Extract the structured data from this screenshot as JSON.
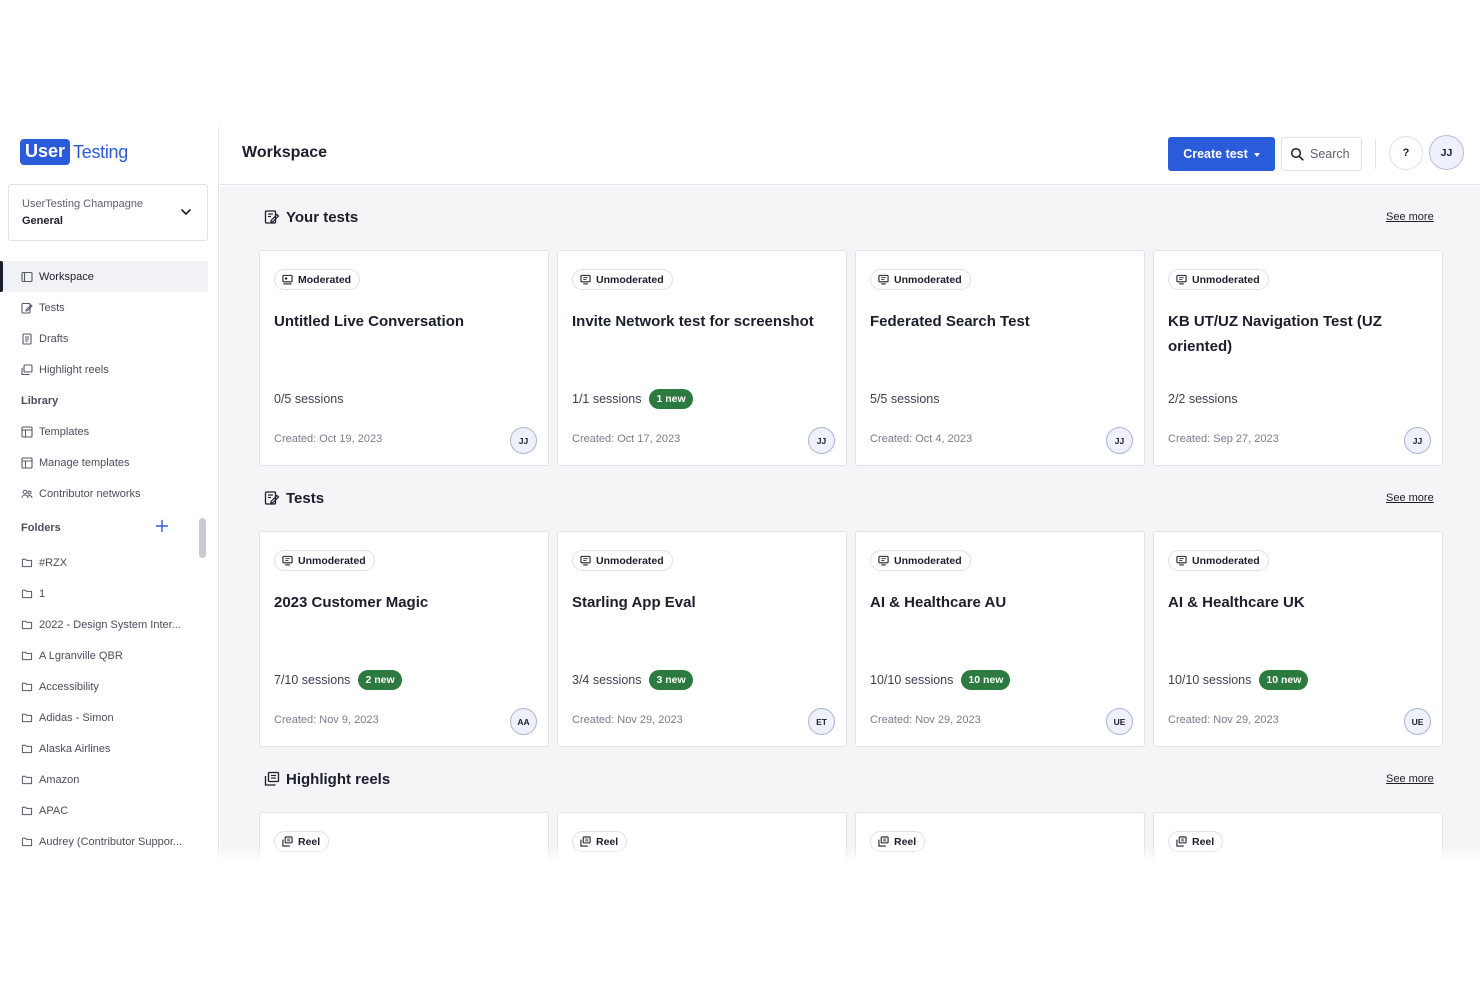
{
  "logo": {
    "part1": "User",
    "part2": "Testing"
  },
  "account": {
    "org": "UserTesting Champagne",
    "workspace": "General"
  },
  "nav": {
    "workspace": "Workspace",
    "tests": "Tests",
    "drafts": "Drafts",
    "highlight_reels": "Highlight reels",
    "library_label": "Library",
    "templates": "Templates",
    "manage_templates": "Manage templates",
    "contributor_networks": "Contributor networks"
  },
  "folders": {
    "label": "Folders",
    "items": [
      "#RZX",
      "1",
      "2022 - Design System Inter...",
      "A Lgranville QBR",
      "Accessibility",
      "Adidas - Simon",
      "Alaska Airlines",
      "Amazon",
      "APAC",
      "Audrey (Contributor Suppor..."
    ]
  },
  "header": {
    "title": "Workspace",
    "create_label": "Create test",
    "search_label": "Search",
    "help_label": "?",
    "user_initials": "JJ"
  },
  "sections": {
    "your_tests": {
      "title": "Your tests",
      "see_more": "See more",
      "cards": [
        {
          "type": "Moderated",
          "title": "Untitled Live Conversation",
          "sessions": "0/5 sessions",
          "new": "",
          "created": "Created: Oct 19, 2023",
          "owner": "JJ"
        },
        {
          "type": "Unmoderated",
          "title": "Invite Network test for screenshot",
          "sessions": "1/1 sessions",
          "new": "1 new",
          "created": "Created: Oct 17, 2023",
          "owner": "JJ"
        },
        {
          "type": "Unmoderated",
          "title": "Federated Search Test",
          "sessions": "5/5 sessions",
          "new": "",
          "created": "Created: Oct 4, 2023",
          "owner": "JJ"
        },
        {
          "type": "Unmoderated",
          "title": "KB UT/UZ Navigation Test (UZ oriented)",
          "sessions": "2/2 sessions",
          "new": "",
          "created": "Created: Sep 27, 2023",
          "owner": "JJ"
        }
      ]
    },
    "tests": {
      "title": "Tests",
      "see_more": "See more",
      "cards": [
        {
          "type": "Unmoderated",
          "title": "2023 Customer Magic",
          "sessions": "7/10 sessions",
          "new": "2 new",
          "created": "Created: Nov 9, 2023",
          "owner": "AA"
        },
        {
          "type": "Unmoderated",
          "title": "Starling App Eval",
          "sessions": "3/4 sessions",
          "new": "3 new",
          "created": "Created: Nov 29, 2023",
          "owner": "ET"
        },
        {
          "type": "Unmoderated",
          "title": "AI & Healthcare AU",
          "sessions": "10/10 sessions",
          "new": "10 new",
          "created": "Created: Nov 29, 2023",
          "owner": "UE"
        },
        {
          "type": "Unmoderated",
          "title": "AI & Healthcare UK",
          "sessions": "10/10 sessions",
          "new": "10 new",
          "created": "Created: Nov 29, 2023",
          "owner": "UE"
        }
      ]
    },
    "highlight_reels": {
      "title": "Highlight reels",
      "see_more": "See more",
      "cards": [
        {
          "type": "Reel"
        },
        {
          "type": "Reel"
        },
        {
          "type": "Reel"
        },
        {
          "type": "Reel"
        }
      ]
    }
  },
  "colors": {
    "brand_blue": "#2a5bdb",
    "new_green": "#2c7a3f",
    "main_bg": "#f4f5f7"
  }
}
